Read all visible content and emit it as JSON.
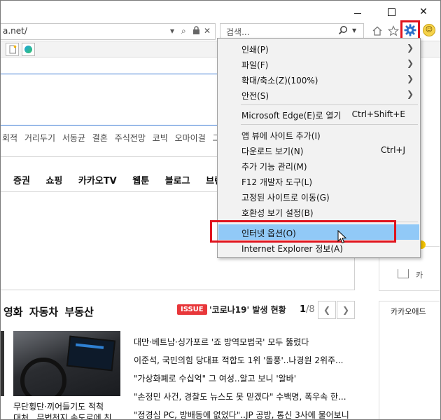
{
  "window": {
    "min_glyph": "",
    "max_glyph": "",
    "close_glyph": "✕"
  },
  "address_bar": {
    "url": "a.net/"
  },
  "search": {
    "placeholder": "검색..."
  },
  "page": {
    "keywords": "회적 거리두기 서동균 결혼 주식전망 코빅 오마이걸 그리드",
    "nav": [
      "증권",
      "쇼핑",
      "카카오TV",
      "웹툰",
      "블로그",
      "브런치"
    ],
    "section_title": "영화 자동차 부동산",
    "issue_badge": "ISSUE",
    "issue_text": "'코로나19' 발생 현황",
    "pager_current": "1",
    "pager_total": "/8",
    "side_text": "카",
    "side_text2": "카카오애드",
    "caption_line1": "무단횡단·끼어들기도 적척",
    "caption_line2": "대처...무법천지 속도로에 친",
    "news": [
      "대만·베트남·싱가포르 '죠 방역모범국' 모두 뚫렸다",
      "이준석, 국민의힘 당대표 적합도 1위 '돌풍'..나경원 2위주...",
      "\"가상화폐로 수십억\" 그 여성..알고 보니 '알바'",
      "\"손정민 사건, 경찰도 뉴스도 못 믿겠다\" 수백명, 폭우속 한...",
      "\"정경심 PC, 방배동에 없었다\"..JP 공방, 통신 3사에 물어보니"
    ]
  },
  "menu": {
    "items": [
      {
        "label": "인쇄(P)",
        "shortcut": "",
        "submenu": true
      },
      {
        "label": "파일(F)",
        "shortcut": "",
        "submenu": true
      },
      {
        "label": "확대/축소(Z)(100%)",
        "shortcut": "",
        "submenu": true
      },
      {
        "label": "안전(S)",
        "shortcut": "",
        "submenu": true
      },
      {
        "label": "Microsoft Edge(E)로 열기",
        "shortcut": "Ctrl+Shift+E",
        "submenu": false
      },
      {
        "label": "앱 뷰에 사이트 추가(I)",
        "shortcut": "",
        "submenu": false
      },
      {
        "label": "다운로드 보기(N)",
        "shortcut": "Ctrl+J",
        "submenu": false
      },
      {
        "label": "추가 기능 관리(M)",
        "shortcut": "",
        "submenu": false
      },
      {
        "label": "F12 개발자 도구(L)",
        "shortcut": "",
        "submenu": false
      },
      {
        "label": "고정된 사이트로 이동(G)",
        "shortcut": "",
        "submenu": false
      },
      {
        "label": "호환성 보기 설정(B)",
        "shortcut": "",
        "submenu": false
      },
      {
        "label": "인터넷 옵션(O)",
        "shortcut": "",
        "submenu": false,
        "highlighted": true
      },
      {
        "label": "Internet Explorer 정보(A)",
        "shortcut": "",
        "submenu": false
      }
    ]
  },
  "colors": {
    "highlight": "#91c9f7",
    "annotation_red": "#e0141e",
    "issue_red": "#e8373a"
  }
}
